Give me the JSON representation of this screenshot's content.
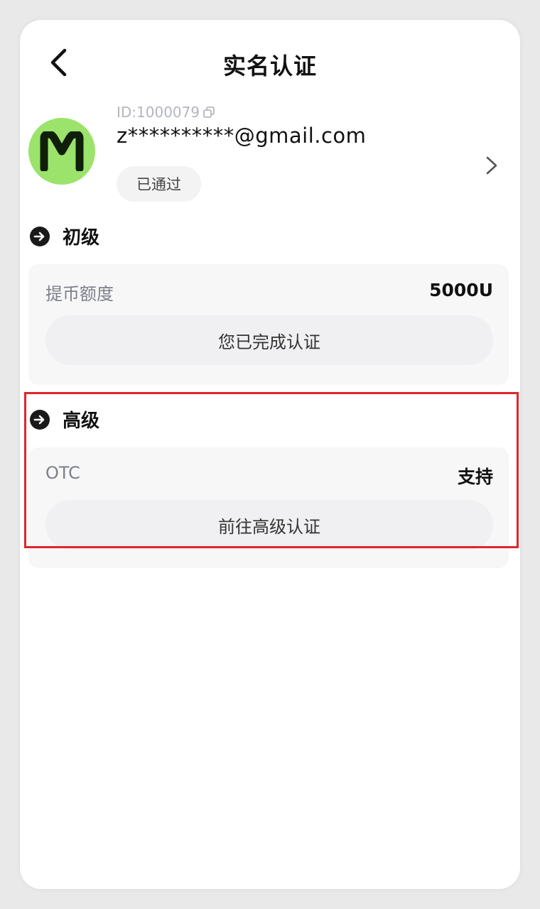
{
  "header": {
    "title": "实名认证"
  },
  "profile": {
    "id_text": "ID:1000079",
    "email": "z**********@gmail.com",
    "avatar_letter": "M",
    "status_badge": "已通过"
  },
  "sections": {
    "basic": {
      "title": "初级",
      "label": "提币额度",
      "value": "5000U",
      "button": "您已完成认证"
    },
    "advanced": {
      "title": "高级",
      "label": "OTC",
      "value": "支持",
      "button": "前往高级认证"
    }
  },
  "colors": {
    "avatar_bg": "#9be36a",
    "highlight_border": "#e0262b",
    "card_bg": "#f7f7f8"
  },
  "icons": [
    "back-arrow-icon",
    "copy-icon",
    "chevron-right-icon",
    "arrow-circle-icon"
  ]
}
